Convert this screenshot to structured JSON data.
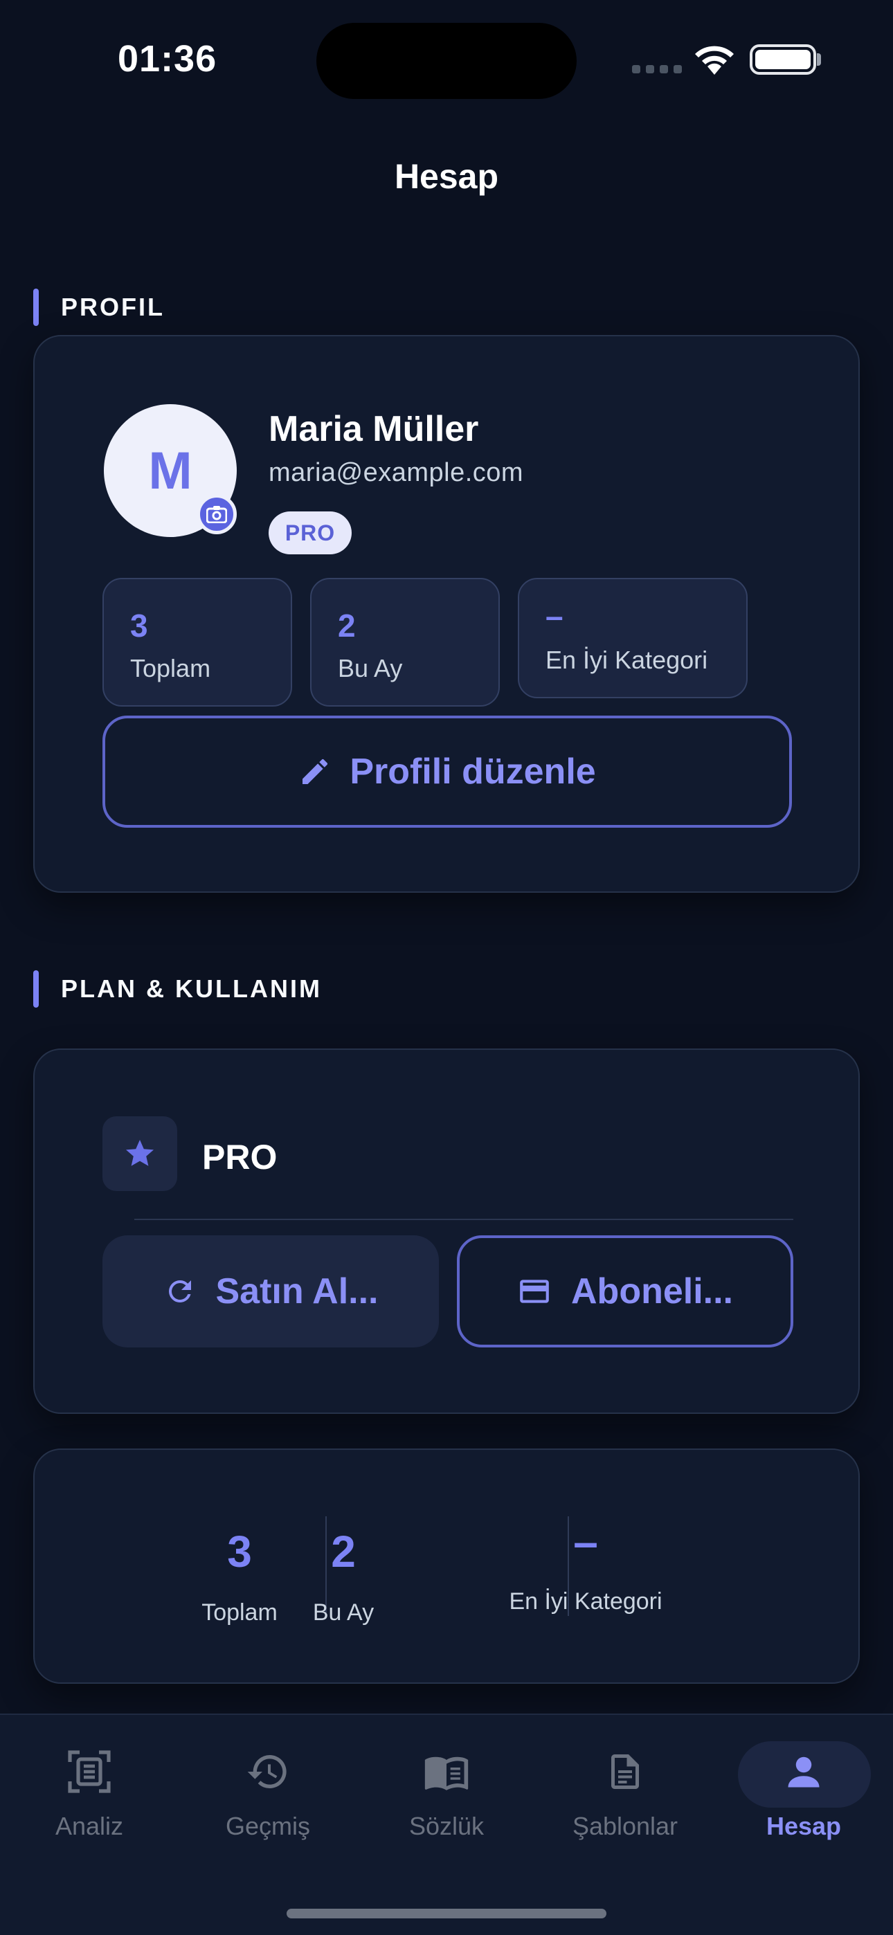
{
  "status_bar": {
    "time": "01:36"
  },
  "header": {
    "title": "Hesap"
  },
  "colors": {
    "accent": "#7c83f5",
    "background": "#0b1120",
    "card": "#111a2e"
  },
  "profile_section": {
    "label": "PROFIL",
    "avatar_initial": "M",
    "name": "Maria Müller",
    "email": "maria@example.com",
    "badge": "PRO",
    "stats": [
      {
        "value": "3",
        "label": "Toplam"
      },
      {
        "value": "2",
        "label": "Bu Ay"
      },
      {
        "value": "–",
        "label": "En İyi Kategori"
      }
    ],
    "edit_button": {
      "label": "Profili düzenle",
      "icon": "pencil-icon"
    }
  },
  "plan_section": {
    "label": "PLAN & KULLANIM",
    "plan_name": "PRO",
    "plan_icon": "star-icon",
    "restore_button": {
      "label": "Satın Al...",
      "icon": "refresh-icon"
    },
    "subscription_button": {
      "label": "Aboneli...",
      "icon": "credit-card-icon"
    }
  },
  "summary": [
    {
      "value": "3",
      "label": "Toplam"
    },
    {
      "value": "2",
      "label": "Bu Ay"
    },
    {
      "value": "–",
      "label": "En İyi Kategori"
    }
  ],
  "tabbar": {
    "items": [
      {
        "label": "Analiz",
        "icon": "scan-document-icon",
        "active": false
      },
      {
        "label": "Geçmiş",
        "icon": "history-icon",
        "active": false
      },
      {
        "label": "Sözlük",
        "icon": "book-icon",
        "active": false
      },
      {
        "label": "Şablonlar",
        "icon": "template-icon",
        "active": false
      },
      {
        "label": "Hesap",
        "icon": "person-icon",
        "active": true
      }
    ]
  }
}
